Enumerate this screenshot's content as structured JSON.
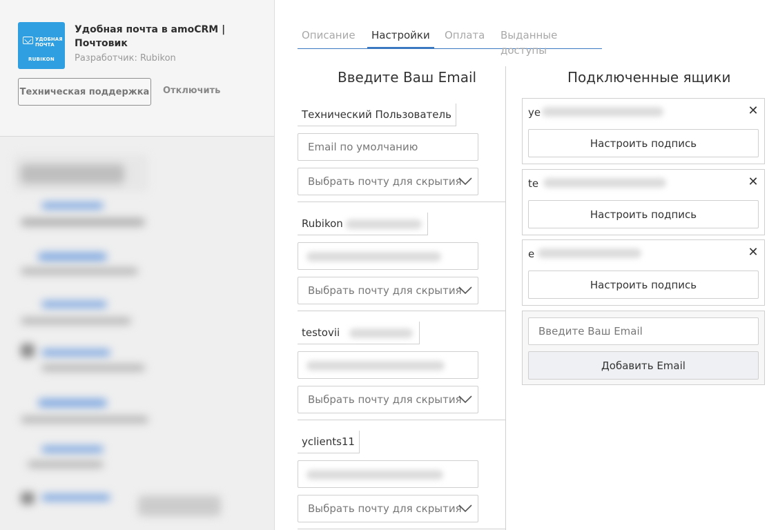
{
  "app": {
    "logo_text": "УДОБНАЯ ПОЧТА",
    "logo_brand": "RUBIKON",
    "title": "Удобная почта в amoCRM | Почтовик",
    "developer": "Разработчик: Rubikon",
    "support_button": "Техническая поддержка",
    "disable_link": "Отключить"
  },
  "tabs": [
    {
      "label": "Описание",
      "active": false
    },
    {
      "label": "Настройки",
      "active": true
    },
    {
      "label": "Оплата",
      "active": false
    },
    {
      "label": "Выданные доступы",
      "active": false
    }
  ],
  "left_column": {
    "title": "Введите Ваш Email",
    "users": [
      {
        "name": "Технический Пользователь",
        "email_placeholder": "Email по умолчанию",
        "select": "Выбрать почту для скрытия"
      },
      {
        "name": "Rubikon",
        "email_placeholder": "",
        "select": "Выбрать почту для скрытия"
      },
      {
        "name": "testovii",
        "email_placeholder": "",
        "select": "Выбрать почту для скрытия"
      },
      {
        "name": "yclients11",
        "email_placeholder": "",
        "select": "Выбрать почту для скрытия"
      }
    ]
  },
  "right_column": {
    "title": "Подключенные ящики",
    "mailboxes": [
      {
        "address": "ye",
        "button": "Настроить подпись"
      },
      {
        "address": "te",
        "button": "Настроить подпись"
      },
      {
        "address": "e",
        "button": "Настроить подпись"
      }
    ],
    "add_placeholder": "Введите Ваш Email",
    "add_button": "Добавить Email"
  },
  "icons": {
    "close": "close-icon",
    "chevron": "chevron-down-icon",
    "envelope": "envelope-icon"
  },
  "colors": {
    "accent": "#3a78c2",
    "logo_bg": "#2f9fe2"
  }
}
